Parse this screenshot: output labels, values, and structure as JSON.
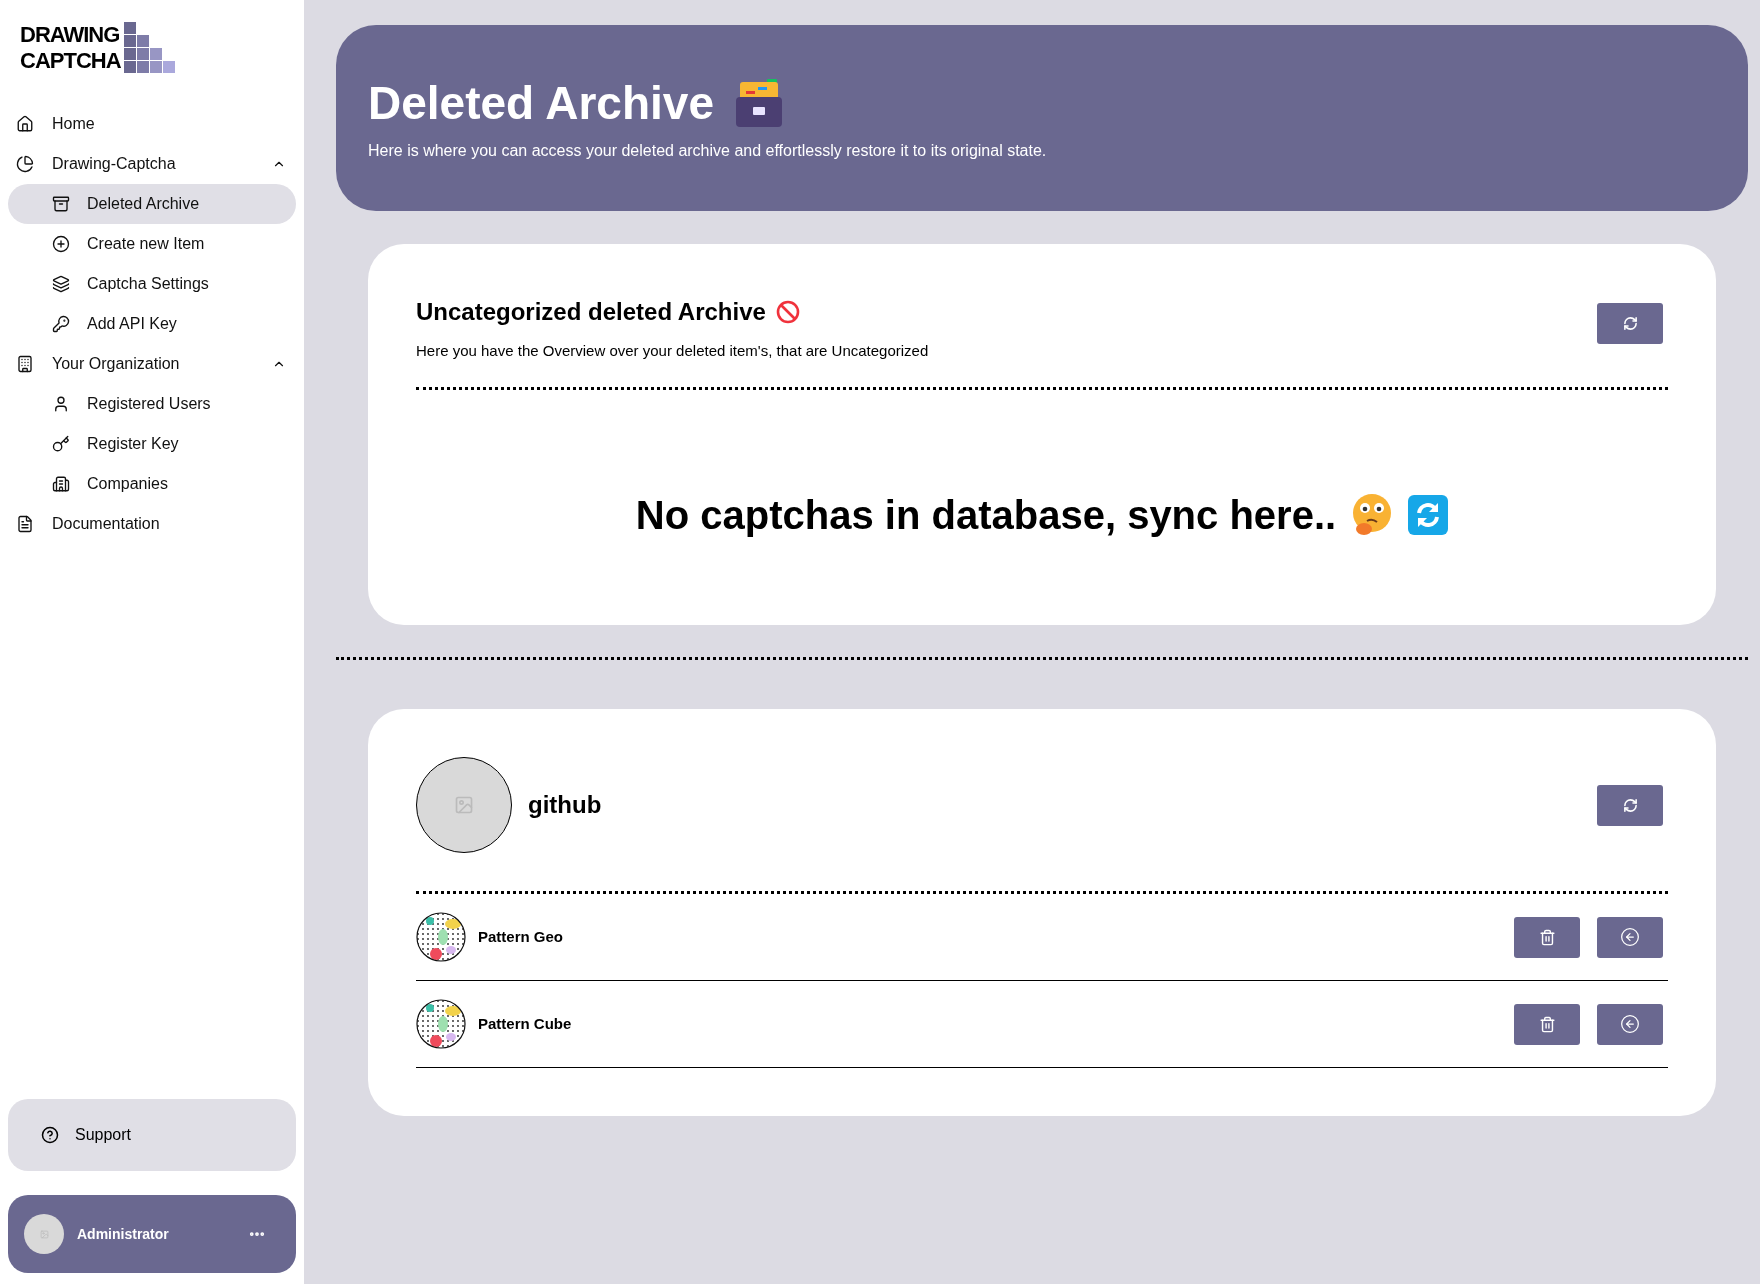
{
  "logo": {
    "lines": [
      "DRAWING",
      "CAPTCHA"
    ]
  },
  "sidebar": {
    "items": [
      {
        "label": "Home",
        "selected": false
      },
      {
        "label": "Drawing-Captcha",
        "selected": false,
        "expanded": true,
        "children": [
          {
            "label": "Deleted Archive",
            "selected": true
          },
          {
            "label": "Create new Item",
            "selected": false
          },
          {
            "label": "Captcha Settings",
            "selected": false
          },
          {
            "label": "Add API Key",
            "selected": false
          }
        ]
      },
      {
        "label": "Your Organization",
        "selected": false,
        "expanded": true,
        "children": [
          {
            "label": "Registered Users",
            "selected": false
          },
          {
            "label": "Register Key",
            "selected": false
          },
          {
            "label": "Companies",
            "selected": false
          }
        ]
      },
      {
        "label": "Documentation",
        "selected": false
      }
    ]
  },
  "support": {
    "label": "Support"
  },
  "user": {
    "name": "Administrator"
  },
  "header": {
    "title": "Deleted Archive",
    "subtitle": "Here is where you can access your deleted archive and effortlessly restore it to its original state."
  },
  "uncategorized": {
    "title": "Uncategorized deleted Archive",
    "description": "Here you have the Overview over your deleted item's, that are Uncategorized",
    "empty_message": "No captchas in database, sync here.."
  },
  "groups": [
    {
      "name": "github",
      "items": [
        {
          "name": "Pattern Geo"
        },
        {
          "name": "Pattern Cube"
        }
      ]
    }
  ]
}
